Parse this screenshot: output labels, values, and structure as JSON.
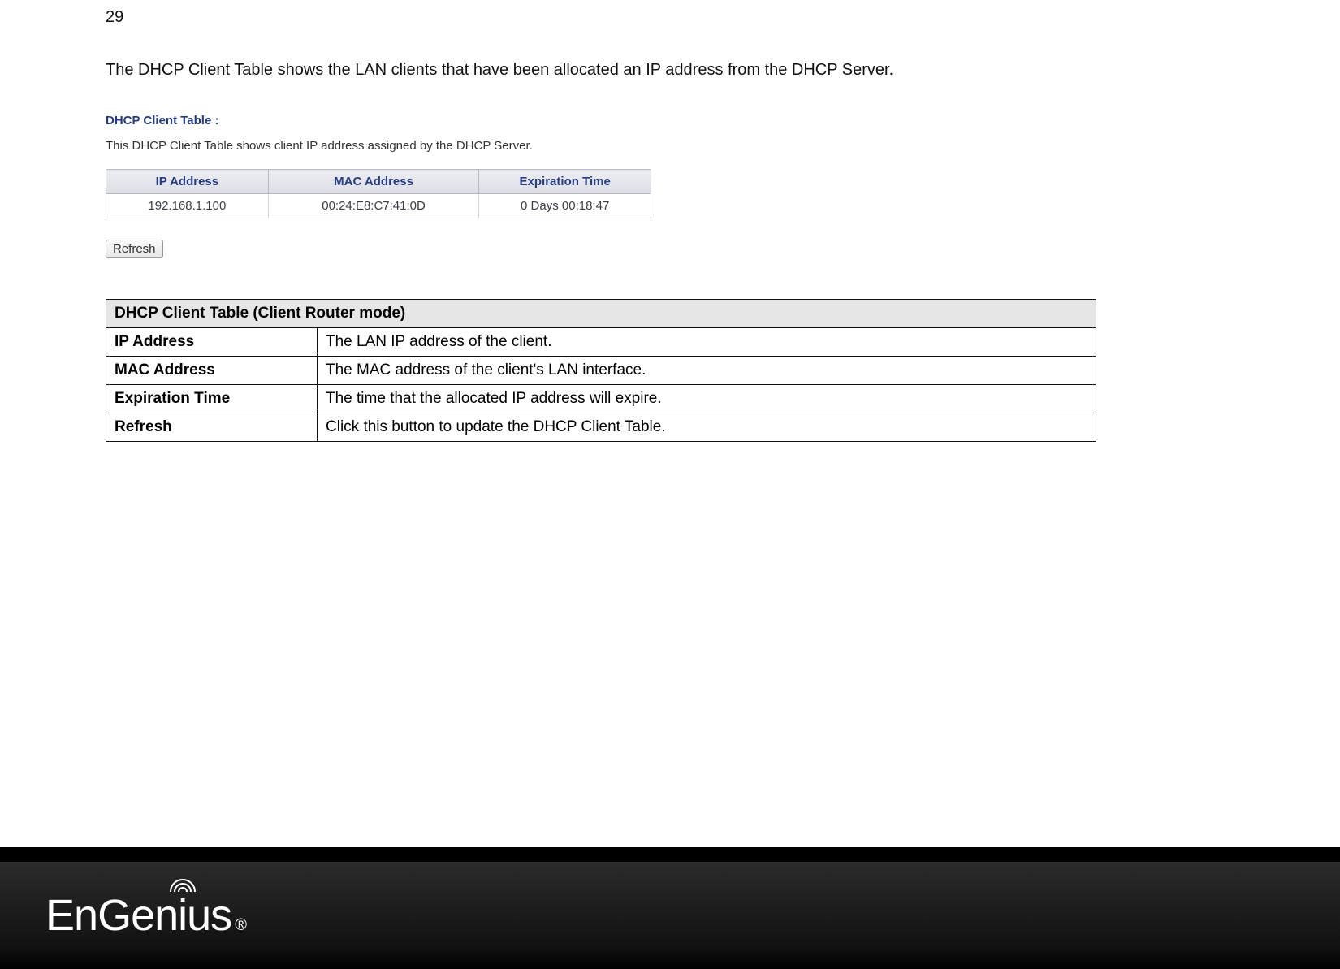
{
  "page": {
    "number": "29",
    "intro": "The DHCP Client Table shows the LAN clients that have been allocated an IP address from the DHCP Server."
  },
  "screenshot": {
    "title": "DHCP Client Table :",
    "description": "This DHCP Client Table shows client IP address assigned by the DHCP Server.",
    "headers": {
      "ip": "IP Address",
      "mac": "MAC Address",
      "exp": "Expiration Time"
    },
    "rows": [
      {
        "ip": "192.168.1.100",
        "mac": "00:24:E8:C7:41:0D",
        "exp": "0 Days 00:18:47"
      }
    ],
    "refresh_label": "Refresh"
  },
  "desc_table": {
    "header": "DHCP Client Table (Client Router mode)",
    "rows": [
      {
        "label": "IP Address",
        "desc": "The LAN IP address of the client."
      },
      {
        "label": "MAC Address",
        "desc": "The MAC address of the client's LAN interface."
      },
      {
        "label": "Expiration Time",
        "desc": "The time that the allocated IP address will expire."
      },
      {
        "label": "Refresh",
        "desc": "Click this button to update the DHCP Client Table."
      }
    ]
  },
  "footer": {
    "brand": "EnGenius",
    "registered": "®"
  }
}
